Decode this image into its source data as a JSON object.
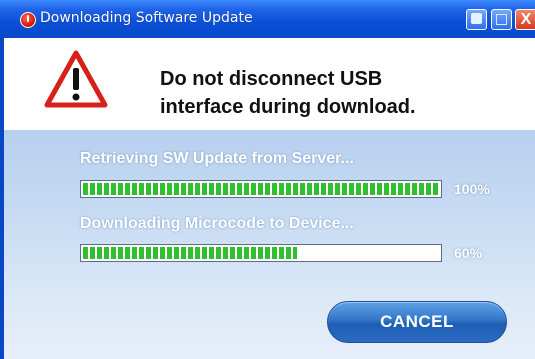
{
  "window": {
    "title": "Downloading Software Update",
    "app_icon": "power-icon",
    "controls": {
      "minimize_icon": "minimize-icon",
      "maximize_icon": "maximize-icon",
      "close_icon": "close-icon",
      "close_glyph": "X"
    }
  },
  "warning": {
    "icon": "warning-icon",
    "line1": "Do not disconnect USB",
    "line2": "interface during download."
  },
  "steps": [
    {
      "label": "Retrieving SW Update from Server...",
      "percent_label": "100%",
      "progress": 1.0
    },
    {
      "label": "Downloading Microcode to Device...",
      "percent_label": "60%",
      "progress": 0.6
    }
  ],
  "actions": {
    "cancel_label": "CANCEL"
  },
  "colors": {
    "titlebar": "#0a4fd6",
    "progress_fill": "#2fbf2f",
    "button": "#2a6cc2",
    "warning_red": "#d8201a"
  }
}
